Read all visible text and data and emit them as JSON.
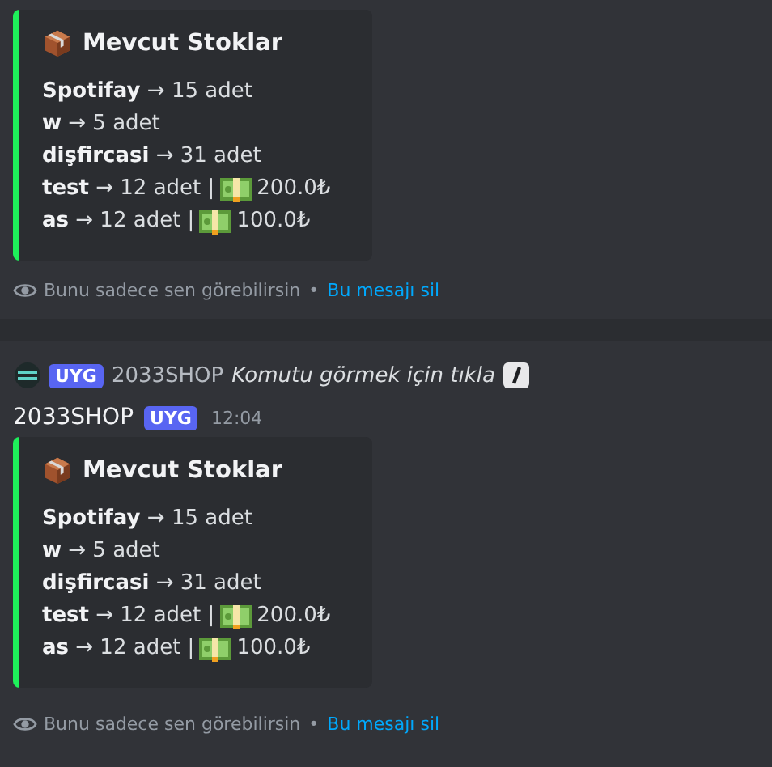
{
  "messages": [
    {
      "embed": {
        "title": "Mevcut Stoklar",
        "lines": [
          {
            "text": "**Spotifay** → 15 adet"
          },
          {
            "text": "**w** → 5 adet"
          },
          {
            "text": "**dişfircasi** → 31 adet"
          },
          {
            "text": "**test** → 12 adet |",
            "price": "200.0₺"
          },
          {
            "text": "**as** → 12 adet |",
            "price": "100.0₺"
          }
        ]
      },
      "footer": {
        "note": "Bunu sadece sen görebilirsin",
        "separator": "•",
        "link": "Bu mesajı sil"
      }
    },
    {
      "header": {
        "reply_tag": "UYG",
        "reply_author": "2033SHOP",
        "reply_text": "Komutu görmek için tıkla",
        "author": "2033SHOP",
        "tag": "UYG",
        "time": "12:04"
      },
      "embed": {
        "title": "Mevcut Stoklar",
        "lines": [
          {
            "text": "**Spotifay** → 15 adet"
          },
          {
            "text": "**w** → 5 adet"
          },
          {
            "text": "**dişfircasi** → 31 adet"
          },
          {
            "text": "**test** → 12 adet |",
            "price": "200.0₺"
          },
          {
            "text": "**as** → 12 adet |",
            "price": "100.0₺"
          }
        ]
      },
      "footer": {
        "note": "Bunu sadece sen görebilirsin",
        "separator": "•",
        "link": "Bu mesajı sil"
      }
    }
  ]
}
